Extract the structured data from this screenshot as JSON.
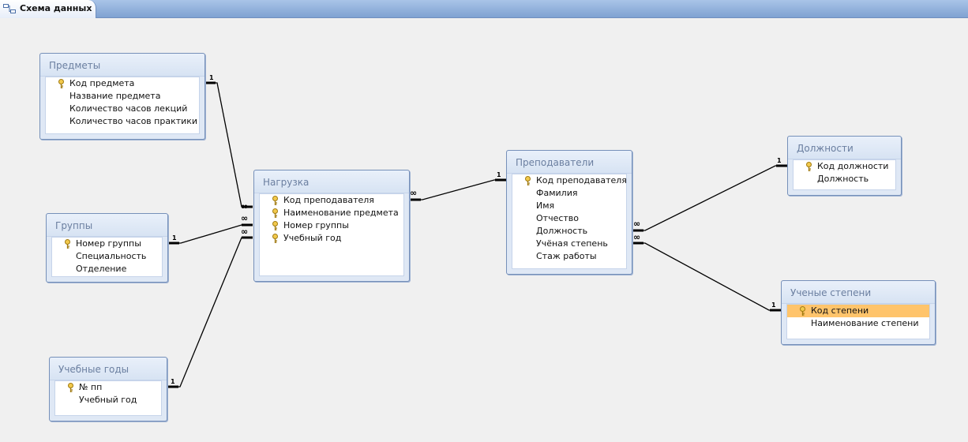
{
  "tab": {
    "title": "Схема данных",
    "icon": "relationships-icon"
  },
  "tables": {
    "predmety": {
      "title": "Предметы",
      "fields": [
        {
          "name": "Код предмета",
          "key": true
        },
        {
          "name": "Название предмета",
          "key": false
        },
        {
          "name": "Количество часов лекций",
          "key": false
        },
        {
          "name": "Количество часов практики",
          "key": false
        }
      ]
    },
    "gruppy": {
      "title": "Группы",
      "fields": [
        {
          "name": "Номер группы",
          "key": true
        },
        {
          "name": "Специальность",
          "key": false
        },
        {
          "name": "Отделение",
          "key": false
        }
      ]
    },
    "uchebnye_gody": {
      "title": "Учебные годы",
      "fields": [
        {
          "name": "№ пп",
          "key": true
        },
        {
          "name": "Учебный год",
          "key": false
        }
      ]
    },
    "nagruzka": {
      "title": "Нагрузка",
      "fields": [
        {
          "name": "Код преподавателя",
          "key": true
        },
        {
          "name": "Наименование предмета",
          "key": true
        },
        {
          "name": "Номер группы",
          "key": true
        },
        {
          "name": "Учебный год",
          "key": true
        }
      ]
    },
    "prepodavateli": {
      "title": "Преподаватели",
      "fields": [
        {
          "name": "Код преподавателя",
          "key": true
        },
        {
          "name": "Фамилия",
          "key": false
        },
        {
          "name": "Имя",
          "key": false
        },
        {
          "name": "Отчество",
          "key": false
        },
        {
          "name": "Должность",
          "key": false
        },
        {
          "name": "Учёная степень",
          "key": false
        },
        {
          "name": "Стаж работы",
          "key": false
        }
      ]
    },
    "dolzhnosti": {
      "title": "Должности",
      "fields": [
        {
          "name": "Код должности",
          "key": true
        },
        {
          "name": "Должность",
          "key": false
        }
      ]
    },
    "uchenye_stepeni": {
      "title": "Ученые степени",
      "fields": [
        {
          "name": "Код степени",
          "key": true,
          "selected": true
        },
        {
          "name": "Наименование степени",
          "key": false
        }
      ]
    }
  },
  "relationships": [
    {
      "from": "Предметы",
      "to": "Нагрузка",
      "one": "1",
      "many": "∞"
    },
    {
      "from": "Группы",
      "to": "Нагрузка",
      "one": "1",
      "many": "∞"
    },
    {
      "from": "Учебные годы",
      "to": "Нагрузка",
      "one": "1",
      "many": "∞"
    },
    {
      "from": "Преподаватели",
      "to": "Нагрузка",
      "one": "1",
      "many": "∞"
    },
    {
      "from": "Должности",
      "to": "Преподаватели",
      "one": "1",
      "many": "∞"
    },
    {
      "from": "Ученые степени",
      "to": "Преподаватели",
      "one": "1",
      "many": "∞"
    }
  ]
}
